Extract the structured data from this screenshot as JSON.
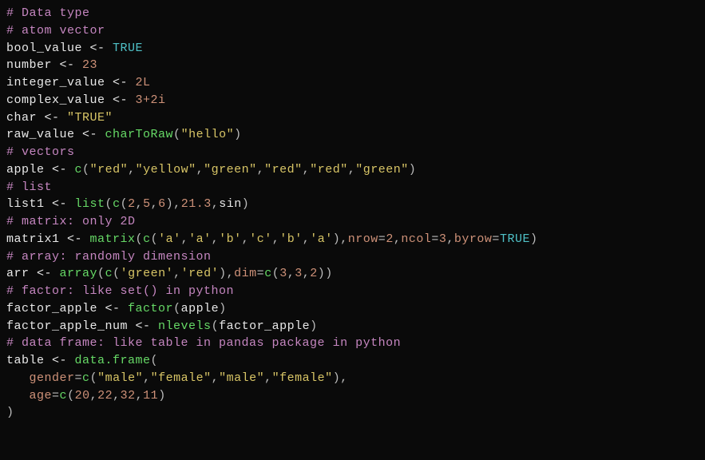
{
  "lines": [
    {
      "tokens": [
        {
          "t": "# Data type",
          "c": "cmt"
        }
      ]
    },
    {
      "tokens": [
        {
          "t": "# atom vector",
          "c": "cmt"
        }
      ]
    },
    {
      "tokens": [
        {
          "t": "bool_value ",
          "c": "id"
        },
        {
          "t": "<- ",
          "c": "op"
        },
        {
          "t": "TRUE",
          "c": "kw"
        }
      ]
    },
    {
      "tokens": [
        {
          "t": "number ",
          "c": "id"
        },
        {
          "t": "<- ",
          "c": "op"
        },
        {
          "t": "23",
          "c": "num"
        }
      ]
    },
    {
      "tokens": [
        {
          "t": "integer_value ",
          "c": "id"
        },
        {
          "t": "<- ",
          "c": "op"
        },
        {
          "t": "2L",
          "c": "num"
        }
      ]
    },
    {
      "tokens": [
        {
          "t": "complex_value ",
          "c": "id"
        },
        {
          "t": "<- ",
          "c": "op"
        },
        {
          "t": "3+2i",
          "c": "num"
        }
      ]
    },
    {
      "tokens": [
        {
          "t": "char ",
          "c": "id"
        },
        {
          "t": "<- ",
          "c": "op"
        },
        {
          "t": "\"TRUE\"",
          "c": "str"
        }
      ]
    },
    {
      "tokens": [
        {
          "t": "raw_value ",
          "c": "id"
        },
        {
          "t": "<- ",
          "c": "op"
        },
        {
          "t": "charToRaw",
          "c": "fn"
        },
        {
          "t": "(",
          "c": "p"
        },
        {
          "t": "\"hello\"",
          "c": "str"
        },
        {
          "t": ")",
          "c": "p"
        }
      ]
    },
    {
      "tokens": [
        {
          "t": "# vectors",
          "c": "cmt"
        }
      ]
    },
    {
      "tokens": [
        {
          "t": "apple ",
          "c": "id"
        },
        {
          "t": "<- ",
          "c": "op"
        },
        {
          "t": "c",
          "c": "fn"
        },
        {
          "t": "(",
          "c": "p"
        },
        {
          "t": "\"red\"",
          "c": "str"
        },
        {
          "t": ",",
          "c": "p"
        },
        {
          "t": "\"yellow\"",
          "c": "str"
        },
        {
          "t": ",",
          "c": "p"
        },
        {
          "t": "\"green\"",
          "c": "str"
        },
        {
          "t": ",",
          "c": "p"
        },
        {
          "t": "\"red\"",
          "c": "str"
        },
        {
          "t": ",",
          "c": "p"
        },
        {
          "t": "\"red\"",
          "c": "str"
        },
        {
          "t": ",",
          "c": "p"
        },
        {
          "t": "\"green\"",
          "c": "str"
        },
        {
          "t": ")",
          "c": "p"
        }
      ]
    },
    {
      "tokens": [
        {
          "t": "# list",
          "c": "cmt"
        }
      ]
    },
    {
      "tokens": [
        {
          "t": "list1 ",
          "c": "id"
        },
        {
          "t": "<- ",
          "c": "op"
        },
        {
          "t": "list",
          "c": "fn"
        },
        {
          "t": "(",
          "c": "p"
        },
        {
          "t": "c",
          "c": "fn"
        },
        {
          "t": "(",
          "c": "p"
        },
        {
          "t": "2",
          "c": "num"
        },
        {
          "t": ",",
          "c": "p"
        },
        {
          "t": "5",
          "c": "num"
        },
        {
          "t": ",",
          "c": "p"
        },
        {
          "t": "6",
          "c": "num"
        },
        {
          "t": "),",
          "c": "p"
        },
        {
          "t": "21.3",
          "c": "num"
        },
        {
          "t": ",",
          "c": "p"
        },
        {
          "t": "sin",
          "c": "id"
        },
        {
          "t": ")",
          "c": "p"
        }
      ]
    },
    {
      "tokens": [
        {
          "t": "# matrix: only 2D",
          "c": "cmt"
        }
      ]
    },
    {
      "tokens": [
        {
          "t": "matrix1 ",
          "c": "id"
        },
        {
          "t": "<- ",
          "c": "op"
        },
        {
          "t": "matrix",
          "c": "fn"
        },
        {
          "t": "(",
          "c": "p"
        },
        {
          "t": "c",
          "c": "fn"
        },
        {
          "t": "(",
          "c": "p"
        },
        {
          "t": "'a'",
          "c": "str"
        },
        {
          "t": ",",
          "c": "p"
        },
        {
          "t": "'a'",
          "c": "str"
        },
        {
          "t": ",",
          "c": "p"
        },
        {
          "t": "'b'",
          "c": "str"
        },
        {
          "t": ",",
          "c": "p"
        },
        {
          "t": "'c'",
          "c": "str"
        },
        {
          "t": ",",
          "c": "p"
        },
        {
          "t": "'b'",
          "c": "str"
        },
        {
          "t": ",",
          "c": "p"
        },
        {
          "t": "'a'",
          "c": "str"
        },
        {
          "t": "),",
          "c": "p"
        },
        {
          "t": "nrow",
          "c": "arg"
        },
        {
          "t": "=",
          "c": "p"
        },
        {
          "t": "2",
          "c": "num"
        },
        {
          "t": ",",
          "c": "p"
        },
        {
          "t": "ncol",
          "c": "arg"
        },
        {
          "t": "=",
          "c": "p"
        },
        {
          "t": "3",
          "c": "num"
        },
        {
          "t": ",",
          "c": "p"
        },
        {
          "t": "byrow",
          "c": "arg"
        },
        {
          "t": "=",
          "c": "p"
        },
        {
          "t": "TRUE",
          "c": "kw"
        },
        {
          "t": ")",
          "c": "p"
        }
      ]
    },
    {
      "tokens": [
        {
          "t": "# array: randomly dimension",
          "c": "cmt"
        }
      ]
    },
    {
      "tokens": [
        {
          "t": "arr ",
          "c": "id"
        },
        {
          "t": "<- ",
          "c": "op"
        },
        {
          "t": "array",
          "c": "fn"
        },
        {
          "t": "(",
          "c": "p"
        },
        {
          "t": "c",
          "c": "fn"
        },
        {
          "t": "(",
          "c": "p"
        },
        {
          "t": "'green'",
          "c": "str"
        },
        {
          "t": ",",
          "c": "p"
        },
        {
          "t": "'red'",
          "c": "str"
        },
        {
          "t": "),",
          "c": "p"
        },
        {
          "t": "dim",
          "c": "arg"
        },
        {
          "t": "=",
          "c": "p"
        },
        {
          "t": "c",
          "c": "fn"
        },
        {
          "t": "(",
          "c": "p"
        },
        {
          "t": "3",
          "c": "num"
        },
        {
          "t": ",",
          "c": "p"
        },
        {
          "t": "3",
          "c": "num"
        },
        {
          "t": ",",
          "c": "p"
        },
        {
          "t": "2",
          "c": "num"
        },
        {
          "t": "))",
          "c": "p"
        }
      ]
    },
    {
      "tokens": [
        {
          "t": "# factor: like set() in python",
          "c": "cmt"
        }
      ]
    },
    {
      "tokens": [
        {
          "t": "factor_apple ",
          "c": "id"
        },
        {
          "t": "<- ",
          "c": "op"
        },
        {
          "t": "factor",
          "c": "fn"
        },
        {
          "t": "(",
          "c": "p"
        },
        {
          "t": "apple",
          "c": "id"
        },
        {
          "t": ")",
          "c": "p"
        }
      ]
    },
    {
      "tokens": [
        {
          "t": "factor_apple_num ",
          "c": "id"
        },
        {
          "t": "<- ",
          "c": "op"
        },
        {
          "t": "nlevels",
          "c": "fn"
        },
        {
          "t": "(",
          "c": "p"
        },
        {
          "t": "factor_apple",
          "c": "id"
        },
        {
          "t": ")",
          "c": "p"
        }
      ]
    },
    {
      "tokens": [
        {
          "t": "# data frame: like table in pandas package in python",
          "c": "cmt"
        }
      ]
    },
    {
      "tokens": [
        {
          "t": "table ",
          "c": "id"
        },
        {
          "t": "<- ",
          "c": "op"
        },
        {
          "t": "data.frame",
          "c": "fn"
        },
        {
          "t": "(",
          "c": "p"
        }
      ]
    },
    {
      "tokens": [
        {
          "t": "   ",
          "c": "id"
        },
        {
          "t": "gender",
          "c": "arg"
        },
        {
          "t": "=",
          "c": "p"
        },
        {
          "t": "c",
          "c": "fn"
        },
        {
          "t": "(",
          "c": "p"
        },
        {
          "t": "\"male\"",
          "c": "str"
        },
        {
          "t": ",",
          "c": "p"
        },
        {
          "t": "\"female\"",
          "c": "str"
        },
        {
          "t": ",",
          "c": "p"
        },
        {
          "t": "\"male\"",
          "c": "str"
        },
        {
          "t": ",",
          "c": "p"
        },
        {
          "t": "\"female\"",
          "c": "str"
        },
        {
          "t": "),",
          "c": "p"
        }
      ]
    },
    {
      "tokens": [
        {
          "t": "   ",
          "c": "id"
        },
        {
          "t": "age",
          "c": "arg"
        },
        {
          "t": "=",
          "c": "p"
        },
        {
          "t": "c",
          "c": "fn"
        },
        {
          "t": "(",
          "c": "p"
        },
        {
          "t": "20",
          "c": "num"
        },
        {
          "t": ",",
          "c": "p"
        },
        {
          "t": "22",
          "c": "num"
        },
        {
          "t": ",",
          "c": "p"
        },
        {
          "t": "32",
          "c": "num"
        },
        {
          "t": ",",
          "c": "p"
        },
        {
          "t": "11",
          "c": "num"
        },
        {
          "t": ")",
          "c": "p"
        }
      ]
    },
    {
      "tokens": [
        {
          "t": ")",
          "c": "p"
        }
      ]
    }
  ]
}
